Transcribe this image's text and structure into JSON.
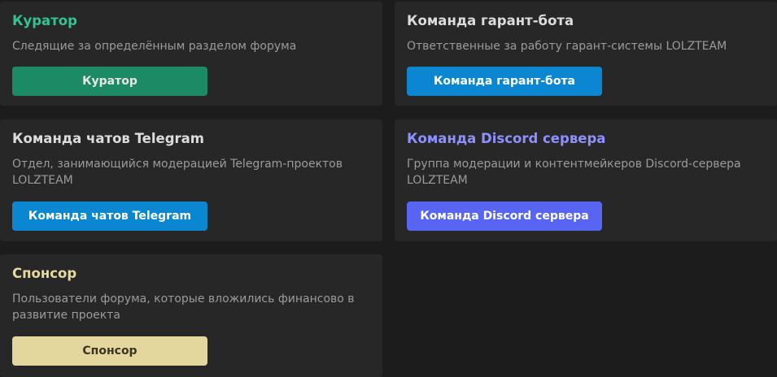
{
  "roles": [
    {
      "title": "Куратор",
      "description": "Следящие за определённым разделом форума",
      "button": "Куратор",
      "title_color": "#2fc492",
      "button_bg": "#1b8a65",
      "button_color": "#e6e6e6"
    },
    {
      "title": "Команда гарант-бота",
      "description": "Ответственные за работу гарант-системы LOLZTEAM",
      "button": "Команда гарант-бота",
      "title_color": "#dcdcdc",
      "button_bg": "#0a87d0",
      "button_color": "#ffffff"
    },
    {
      "title": "Команда чатов Telegram",
      "description": "Отдел, занимающийся модерацией Telegram-проектов LOLZTEAM",
      "button": "Команда чатов Telegram",
      "title_color": "#dcdcdc",
      "button_bg": "#0a87d0",
      "button_color": "#ffffff"
    },
    {
      "title": "Команда Discord сервера",
      "description": "Группа модерации и контентмейкеров Discord-сервера LOLZTEAM",
      "button": "Команда Discord сервера",
      "title_color": "#8f90ff",
      "button_bg": "#5865f2",
      "button_color": "#ffffff"
    },
    {
      "title": "Спонсор",
      "description": "Пользователи форума, которые вложились финансово в развитие проекта",
      "button": "Спонсор",
      "title_color": "#e8d9a0",
      "button_bg": "#e3d79d",
      "button_color": "#3a3523"
    }
  ]
}
